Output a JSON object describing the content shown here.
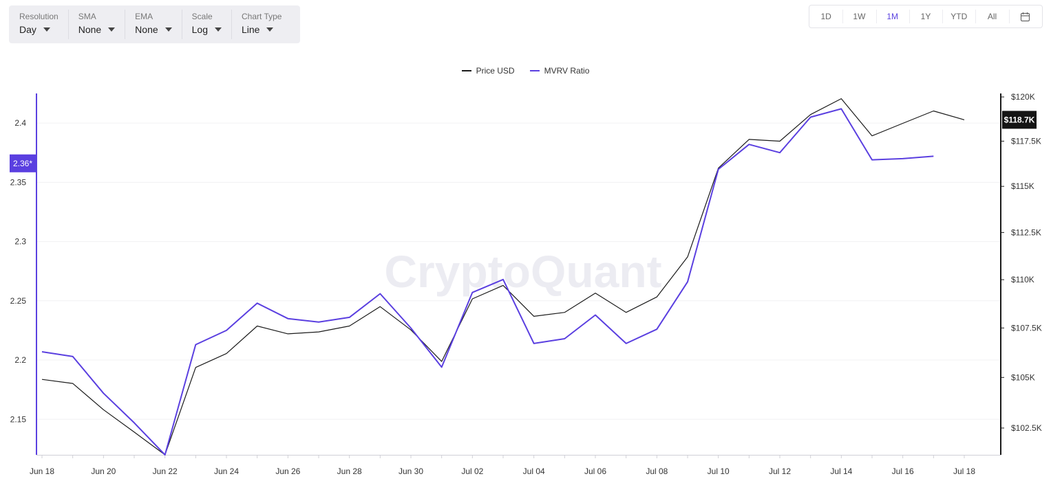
{
  "controls": [
    {
      "label": "Resolution",
      "value": "Day"
    },
    {
      "label": "SMA",
      "value": "None"
    },
    {
      "label": "EMA",
      "value": "None"
    },
    {
      "label": "Scale",
      "value": "Log"
    },
    {
      "label": "Chart Type",
      "value": "Line"
    }
  ],
  "ranges": [
    "1D",
    "1W",
    "1M",
    "1Y",
    "YTD",
    "All"
  ],
  "active_range": "1M",
  "calendar_icon": "calendar-icon",
  "watermark": "CryptoQuant",
  "chart_data": {
    "type": "line",
    "dates": [
      "Jun 18",
      "Jun 19",
      "Jun 20",
      "Jun 21",
      "Jun 22",
      "Jun 23",
      "Jun 24",
      "Jun 25",
      "Jun 26",
      "Jun 27",
      "Jun 28",
      "Jun 29",
      "Jun 30",
      "Jul 01",
      "Jul 02",
      "Jul 03",
      "Jul 04",
      "Jul 05",
      "Jul 06",
      "Jul 07",
      "Jul 08",
      "Jul 09",
      "Jul 10",
      "Jul 11",
      "Jul 12",
      "Jul 13",
      "Jul 14",
      "Jul 15",
      "Jul 16",
      "Jul 17",
      "Jul 18"
    ],
    "x_tick_labels": [
      "Jun 18",
      "Jun 20",
      "Jun 22",
      "Jun 24",
      "Jun 26",
      "Jun 28",
      "Jun 30",
      "Jul 02",
      "Jul 04",
      "Jul 06",
      "Jul 08",
      "Jul 10",
      "Jul 12",
      "Jul 14",
      "Jul 16",
      "Jul 18"
    ],
    "series": [
      {
        "name": "Price USD",
        "axis": "right",
        "color": "#1a1a1a",
        "values": [
          104900,
          104700,
          103400,
          102300,
          101200,
          105500,
          106200,
          107600,
          107200,
          107300,
          107600,
          108600,
          107400,
          105800,
          109000,
          109700,
          108100,
          108300,
          109300,
          108300,
          109100,
          111200,
          116000,
          117600,
          117500,
          119000,
          119900,
          117800,
          118500,
          119200,
          118700
        ]
      },
      {
        "name": "MVRV Ratio",
        "axis": "left",
        "color": "#5a3fe0",
        "values": [
          2.207,
          2.203,
          2.172,
          2.147,
          2.12,
          2.213,
          2.225,
          2.248,
          2.235,
          2.232,
          2.236,
          2.256,
          2.227,
          2.194,
          2.257,
          2.268,
          2.214,
          2.218,
          2.238,
          2.214,
          2.226,
          2.266,
          2.361,
          2.382,
          2.375,
          2.405,
          2.412,
          2.369,
          2.37,
          2.372,
          null
        ]
      }
    ],
    "left_axis": {
      "ticks": [
        "2.15",
        "2.2",
        "2.25",
        "2.3",
        "2.35",
        "2.4"
      ],
      "tick_values": [
        2.15,
        2.2,
        2.25,
        2.3,
        2.35,
        2.4
      ],
      "range": [
        2.12,
        2.425
      ],
      "marker": "2.36*",
      "marker_value": 2.366,
      "color": "#5a3fe0"
    },
    "right_axis": {
      "ticks": [
        "$102.5K",
        "$105K",
        "$107.5K",
        "$110K",
        "$112.5K",
        "$115K",
        "$117.5K",
        "$120K"
      ],
      "tick_values": [
        102500,
        105000,
        107500,
        110000,
        112500,
        115000,
        117500,
        120000
      ],
      "range": [
        101200,
        120200
      ],
      "marker": "$118.7K",
      "marker_value": 118700,
      "color": "#1a1a1a"
    },
    "grid": true,
    "legend_position": "top-center"
  }
}
